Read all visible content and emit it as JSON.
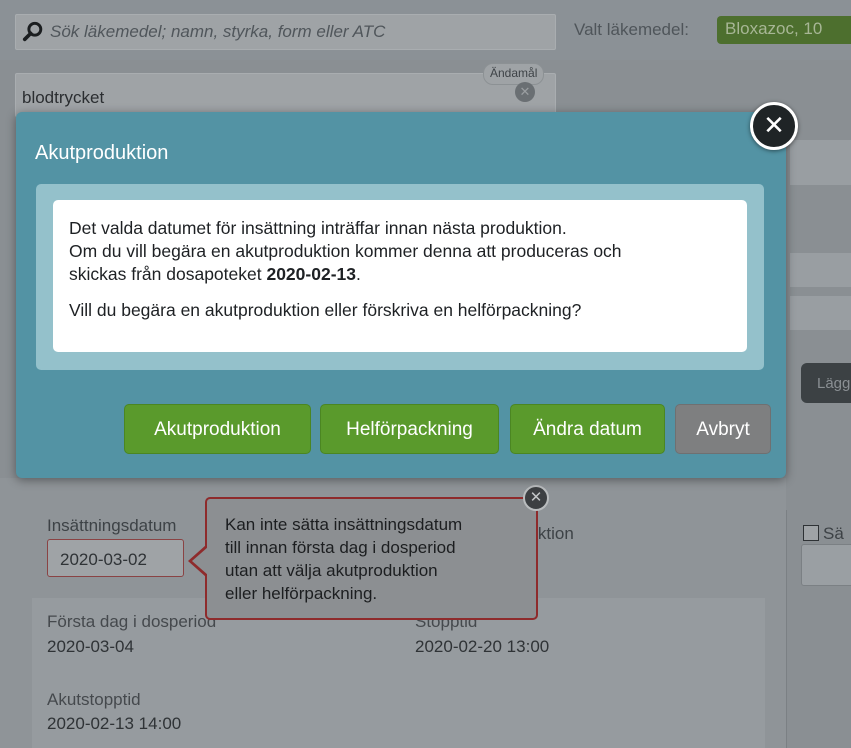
{
  "search": {
    "placeholder": "Sök läkemedel; namn, styrka, form eller ATC",
    "selected_label": "Valt läkemedel:",
    "selected_value": "Bloxazoc, 10"
  },
  "purpose": {
    "value": "blodtrycket",
    "tag": "Ändamål"
  },
  "background": {
    "lagg_button": "Lägg"
  },
  "modal": {
    "title": "Akutproduktion",
    "message_line1": "Det valda datumet för insättning inträffar innan nästa produktion.",
    "message_line2": "Om du vill begära en akutproduktion kommer denna att produceras och",
    "message_line3_prefix": "skickas från dosapoteket ",
    "message_line3_date": "2020-02-13",
    "message_line3_suffix": ".",
    "question": "Vill du begära en akutproduktion eller förskriva en helförpackning?",
    "buttons": {
      "akutproduktion": "Akutproduktion",
      "helforpackning": "Helförpackning",
      "andra_datum": "Ändra datum",
      "avbryt": "Avbryt"
    },
    "colors": {
      "header_bg": "#5393a4",
      "primary_button": "#5a9a2c",
      "cancel_button": "#7e7f80"
    }
  },
  "form": {
    "insattningsdatum_label": "Insättningsdatum",
    "insattningsdatum_value": "2020-03-02",
    "produktion_label_partial": "duktion",
    "sa_label_partial": "Sä"
  },
  "tooltip": {
    "line1": "Kan inte sätta insättningsdatum",
    "line2": "till innan första dag i dosperiod",
    "line3": "utan att välja akutproduktion",
    "line4": "eller helförpackning.",
    "border_color": "#8e2b2c"
  },
  "info": {
    "forsta_dag_label": "Första dag i dosperiod",
    "forsta_dag_value": "2020-03-04",
    "stopptid_label": "Stopptid",
    "stopptid_value": "2020-02-20 13:00",
    "akutstopptid_label": "Akutstopptid",
    "akutstopptid_value": "2020-02-13 14:00"
  }
}
